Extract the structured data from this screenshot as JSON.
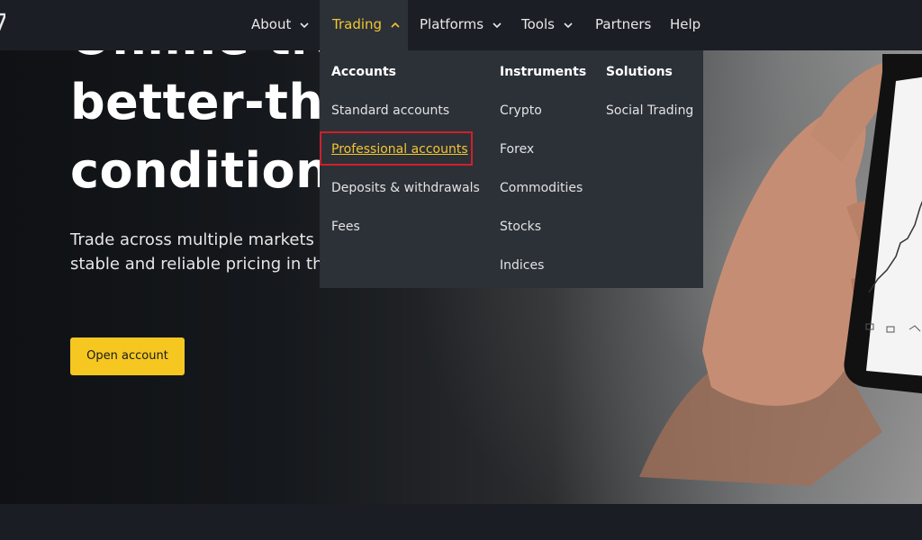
{
  "nav": {
    "items": [
      {
        "label": "About",
        "has_dropdown": true
      },
      {
        "label": "Trading",
        "has_dropdown": true,
        "active": true
      },
      {
        "label": "Platforms",
        "has_dropdown": true
      },
      {
        "label": "Tools",
        "has_dropdown": true
      },
      {
        "label": "Partners",
        "has_dropdown": false
      },
      {
        "label": "Help",
        "has_dropdown": false
      }
    ]
  },
  "dropdown": {
    "columns": [
      {
        "heading": "Accounts",
        "items": [
          "Standard accounts",
          "Professional accounts",
          "Deposits & withdrawals",
          "Fees"
        ]
      },
      {
        "heading": "Instruments",
        "items": [
          "Crypto",
          "Forex",
          "Commodities",
          "Stocks",
          "Indices"
        ]
      },
      {
        "heading": "Solutions",
        "items": [
          "Social Trading"
        ]
      }
    ],
    "highlighted_item": "Professional accounts"
  },
  "hero": {
    "title_lines": [
      "Online tra",
      "better-thar",
      "conditions"
    ],
    "subtitle_lines": [
      "Trade across multiple markets w",
      "stable and reliable pricing in th"
    ],
    "cta_label": "Open account"
  },
  "colors": {
    "accent": "#f3c531",
    "nav_bg": "#1b1e24",
    "dropdown_bg": "#2c3138",
    "highlight_border": "#d0202a",
    "cta_bg": "#f5c720"
  },
  "icons": [
    "chevron-down-icon",
    "chevron-up-icon",
    "logo-icon"
  ]
}
